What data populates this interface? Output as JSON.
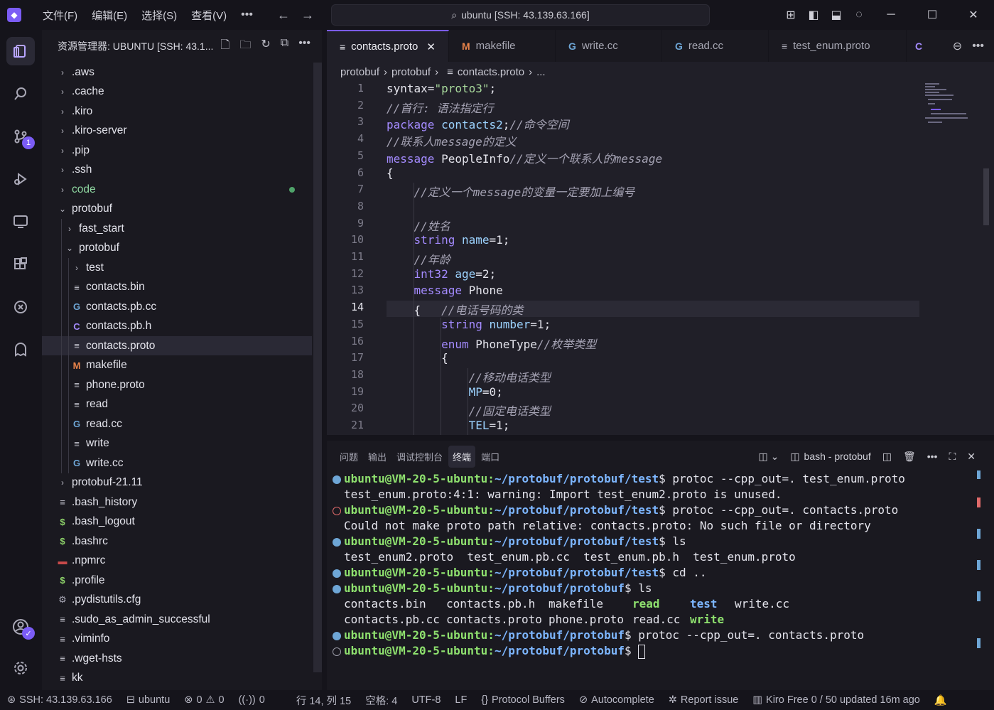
{
  "titlebar": {
    "menu": [
      "文件(F)",
      "编辑(E)",
      "选择(S)",
      "查看(V)"
    ],
    "more": "•••",
    "search": "ubuntu [SSH: 43.139.63.166]"
  },
  "activity": {
    "badge": "1"
  },
  "sidebar": {
    "title": "资源管理器: UBUNTU [SSH: 43.1...",
    "items": [
      {
        "label": ".aws",
        "kind": "folder",
        "depth": 0
      },
      {
        "label": ".cache",
        "kind": "folder",
        "depth": 0
      },
      {
        "label": ".kiro",
        "kind": "folder",
        "depth": 0
      },
      {
        "label": ".kiro-server",
        "kind": "folder",
        "depth": 0
      },
      {
        "label": ".pip",
        "kind": "folder",
        "depth": 0
      },
      {
        "label": ".ssh",
        "kind": "folder",
        "depth": 0
      },
      {
        "label": "code",
        "kind": "folder",
        "depth": 0
      },
      {
        "label": "protobuf",
        "kind": "folder-open",
        "depth": 0
      },
      {
        "label": "fast_start",
        "kind": "folder",
        "depth": 1
      },
      {
        "label": "protobuf",
        "kind": "folder-open",
        "depth": 1
      },
      {
        "label": "test",
        "kind": "folder",
        "depth": 2
      },
      {
        "label": "contacts.bin",
        "kind": "lines",
        "depth": 2
      },
      {
        "label": "contacts.pb.cc",
        "kind": "cpp",
        "depth": 2
      },
      {
        "label": "contacts.pb.h",
        "kind": "c",
        "depth": 2
      },
      {
        "label": "contacts.proto",
        "kind": "lines",
        "depth": 2
      },
      {
        "label": "makefile",
        "kind": "make",
        "depth": 2
      },
      {
        "label": "phone.proto",
        "kind": "lines",
        "depth": 2
      },
      {
        "label": "read",
        "kind": "lines",
        "depth": 2
      },
      {
        "label": "read.cc",
        "kind": "cpp",
        "depth": 2
      },
      {
        "label": "write",
        "kind": "lines",
        "depth": 2
      },
      {
        "label": "write.cc",
        "kind": "cpp",
        "depth": 2
      },
      {
        "label": "protobuf-21.11",
        "kind": "folder",
        "depth": 0
      },
      {
        "label": ".bash_history",
        "kind": "lines",
        "depth": 0
      },
      {
        "label": ".bash_logout",
        "kind": "shell",
        "depth": 0
      },
      {
        "label": ".bashrc",
        "kind": "shell",
        "depth": 0
      },
      {
        "label": ".npmrc",
        "kind": "npm",
        "depth": 0
      },
      {
        "label": ".profile",
        "kind": "shell",
        "depth": 0
      },
      {
        "label": ".pydistutils.cfg",
        "kind": "gear",
        "depth": 0
      },
      {
        "label": ".sudo_as_admin_successful",
        "kind": "lines",
        "depth": 0
      },
      {
        "label": ".viminfo",
        "kind": "lines",
        "depth": 0
      },
      {
        "label": ".wget-hsts",
        "kind": "lines",
        "depth": 0
      },
      {
        "label": "kk",
        "kind": "lines",
        "depth": 0
      }
    ]
  },
  "tabs": [
    {
      "label": "contacts.proto",
      "icon": "≡",
      "close": "✕"
    },
    {
      "label": "makefile",
      "icon": "M"
    },
    {
      "label": "write.cc",
      "icon": "G"
    },
    {
      "label": "read.cc",
      "icon": "G"
    },
    {
      "label": "test_enum.proto",
      "icon": "≡"
    },
    {
      "label": "",
      "icon": "C"
    }
  ],
  "breadcrumb": [
    "protobuf",
    "protobuf",
    "contacts.proto",
    "..."
  ],
  "editor": {
    "current_line": 14,
    "lines": [
      {
        "n": "1",
        "t": [
          [
            "id",
            "syntax="
          ],
          [
            "str",
            "\"proto3\""
          ],
          [
            "id",
            ";"
          ]
        ]
      },
      {
        "n": "2",
        "t": [
          [
            "cm",
            "//首行: 语法指定行"
          ]
        ]
      },
      {
        "n": "3",
        "t": [
          [
            "kw",
            "package "
          ],
          [
            "var",
            "contacts2"
          ],
          [
            "id",
            ";"
          ],
          [
            "cm",
            "//命令空间"
          ]
        ]
      },
      {
        "n": "4",
        "t": [
          [
            "cm",
            "//联系人message的定义"
          ]
        ]
      },
      {
        "n": "5",
        "t": [
          [
            "kw",
            "message "
          ],
          [
            "id",
            "PeopleInfo"
          ],
          [
            "cm",
            "//定义一个联系人的message"
          ]
        ]
      },
      {
        "n": "6",
        "t": [
          [
            "id",
            "{"
          ]
        ]
      },
      {
        "n": "7",
        "t": [
          [
            "cm",
            "    //定义一个message的变量一定要加上编号"
          ]
        ]
      },
      {
        "n": "8",
        "t": []
      },
      {
        "n": "9",
        "t": [
          [
            "cm",
            "    //姓名"
          ]
        ]
      },
      {
        "n": "10",
        "t": [
          [
            "typ",
            "    string "
          ],
          [
            "var",
            "name"
          ],
          [
            "id",
            "=1;"
          ]
        ]
      },
      {
        "n": "11",
        "t": [
          [
            "cm",
            "    //年龄"
          ]
        ]
      },
      {
        "n": "12",
        "t": [
          [
            "typ",
            "    int32 "
          ],
          [
            "var",
            "age"
          ],
          [
            "id",
            "=2;"
          ]
        ]
      },
      {
        "n": "13",
        "t": [
          [
            "kw",
            "    message "
          ],
          [
            "id",
            "Phone"
          ]
        ]
      },
      {
        "n": "14",
        "t": [
          [
            "id",
            "    {   "
          ],
          [
            "cm",
            "//电话号码的类"
          ]
        ]
      },
      {
        "n": "15",
        "t": [
          [
            "typ",
            "        string "
          ],
          [
            "var",
            "number"
          ],
          [
            "id",
            "=1;"
          ]
        ]
      },
      {
        "n": "16",
        "t": [
          [
            "kw",
            "        enum "
          ],
          [
            "id",
            "PhoneType"
          ],
          [
            "cm",
            "//枚举类型"
          ]
        ]
      },
      {
        "n": "17",
        "t": [
          [
            "id",
            "        {"
          ]
        ]
      },
      {
        "n": "18",
        "t": [
          [
            "cm",
            "            //移动电话类型"
          ]
        ]
      },
      {
        "n": "19",
        "t": [
          [
            "var",
            "            MP"
          ],
          [
            "id",
            "=0;"
          ]
        ]
      },
      {
        "n": "20",
        "t": [
          [
            "cm",
            "            //固定电话类型"
          ]
        ]
      },
      {
        "n": "21",
        "t": [
          [
            "var",
            "            TEL"
          ],
          [
            "id",
            "=1;"
          ]
        ]
      }
    ]
  },
  "panel": {
    "tabs": [
      "问题",
      "输出",
      "调试控制台",
      "终端",
      "端口"
    ],
    "active_tab": "终端",
    "terminal_name": "bash - protobuf",
    "prompt_user": "ubuntu@VM-20-5-ubuntu",
    "lines": [
      {
        "mark": "blue",
        "type": "prompt",
        "path": "~/protobuf/protobuf/test",
        "cmd": " protoc --cpp_out=. test_enum.proto"
      },
      {
        "mark": "",
        "type": "out",
        "text": "test_enum.proto:4:1: warning: Import test_enum2.proto is unused."
      },
      {
        "mark": "err",
        "type": "prompt",
        "path": "~/protobuf/protobuf/test",
        "cmd": " protoc --cpp_out=. contacts.proto"
      },
      {
        "mark": "",
        "type": "out",
        "text": "Could not make proto path relative: contacts.proto: No such file or directory"
      },
      {
        "mark": "blue",
        "type": "prompt",
        "path": "~/protobuf/protobuf/test",
        "cmd": " ls"
      },
      {
        "mark": "",
        "type": "out",
        "text": "test_enum2.proto  test_enum.pb.cc  test_enum.pb.h  test_enum.proto"
      },
      {
        "mark": "blue",
        "type": "prompt",
        "path": "~/protobuf/protobuf/test",
        "cmd": " cd .."
      },
      {
        "mark": "blue",
        "type": "prompt",
        "path": "~/protobuf/protobuf",
        "cmd": " ls"
      },
      {
        "mark": "",
        "type": "ls1"
      },
      {
        "mark": "",
        "type": "ls2"
      },
      {
        "mark": "blue",
        "type": "prompt",
        "path": "~/protobuf/protobuf",
        "cmd": " protoc --cpp_out=. contacts.proto"
      },
      {
        "mark": "idle",
        "type": "prompt-cursor",
        "path": "~/protobuf/protobuf",
        "cmd": " "
      }
    ],
    "ls1": [
      "contacts.bin",
      "contacts.pb.h",
      "makefile",
      "read",
      "test",
      "write.cc"
    ],
    "ls2": [
      "contacts.pb.cc",
      "contacts.proto",
      "phone.proto",
      "read.cc",
      "write"
    ]
  },
  "status": {
    "remote": "SSH: 43.139.63.166",
    "workspace": "ubuntu",
    "errors": "0",
    "warnings": "0",
    "ports": "0",
    "position": "行 14, 列 15",
    "spaces": "空格: 4",
    "encoding": "UTF-8",
    "eol": "LF",
    "language": "Protocol Buffers",
    "autocomplete": "Autocomplete",
    "report": "Report issue",
    "kiro": "Kiro Free 0 / 50 updated 16m ago"
  },
  "colors": {
    "accent": "#7b5cf5",
    "background": "#15141b",
    "editor": "#201f28"
  }
}
